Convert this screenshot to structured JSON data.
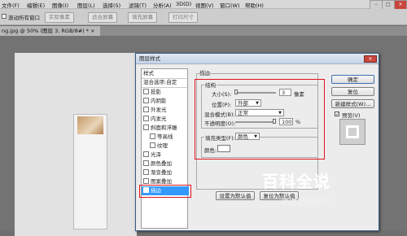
{
  "menubar": {
    "items": [
      "文件(F)",
      "编辑(E)",
      "图像(I)",
      "图层(L)",
      "选择(S)",
      "滤镜(T)",
      "分析(A)",
      "3D(D)",
      "视图(V)",
      "窗口(W)",
      "帮助(H)"
    ]
  },
  "optbar": {
    "scroll_all_label": "滚动所有窗口",
    "actual_pixels": "实际像素",
    "fit_screen": "适合屏幕",
    "fill_screen": "填充屏幕",
    "print_size": "打印尺寸"
  },
  "document": {
    "tab_label": "ng.jpg @ 50% (图层 3, RGB/8#) * ×"
  },
  "dialog": {
    "title": "图层样式",
    "close": "×",
    "style_list": {
      "header": "样式",
      "blend_options": "混合选项:自定",
      "items": [
        {
          "label": "投影",
          "indent": false,
          "selected": false,
          "checked": false
        },
        {
          "label": "内阴影",
          "indent": false,
          "selected": false,
          "checked": false
        },
        {
          "label": "外发光",
          "indent": false,
          "selected": false,
          "checked": false
        },
        {
          "label": "内发光",
          "indent": false,
          "selected": false,
          "checked": false
        },
        {
          "label": "斜面和浮雕",
          "indent": false,
          "selected": false,
          "checked": false
        },
        {
          "label": "等高线",
          "indent": true,
          "selected": false,
          "checked": false
        },
        {
          "label": "纹理",
          "indent": true,
          "selected": false,
          "checked": false
        },
        {
          "label": "光泽",
          "indent": false,
          "selected": false,
          "checked": false
        },
        {
          "label": "颜色叠加",
          "indent": false,
          "selected": false,
          "checked": false
        },
        {
          "label": "渐变叠加",
          "indent": false,
          "selected": false,
          "checked": false
        },
        {
          "label": "图案叠加",
          "indent": false,
          "selected": false,
          "checked": false
        },
        {
          "label": "描边",
          "indent": false,
          "selected": true,
          "checked": true
        }
      ]
    },
    "stroke": {
      "section_title": "描边",
      "structure_title": "结构",
      "size_label": "大小(S):",
      "size_value": "3",
      "size_unit": "像素",
      "position_label": "位置(P):",
      "position_value": "外部",
      "blend_label": "混合模式(B):",
      "blend_value": "正常",
      "opacity_label": "不透明度(O):",
      "opacity_value": "100",
      "opacity_unit": "%",
      "opacity_fraction": 1.0,
      "size_fraction": 0.02,
      "fill_type_label": "填充类型(F):",
      "fill_type_value": "颜色",
      "color_label": "颜色:",
      "color_hex": "#ffffff"
    },
    "buttons": {
      "ok": "确定",
      "reset": "复位",
      "new_style": "新建样式(W)...",
      "preview_label": "预览(V)",
      "set_default": "设置为默认值",
      "reset_default": "复位为默认值"
    }
  },
  "watermark": {
    "title": "百科全说",
    "subtitle": "助你轻松解决"
  },
  "colors": {
    "highlight": "#e0141e",
    "selection": "#3399ff"
  }
}
